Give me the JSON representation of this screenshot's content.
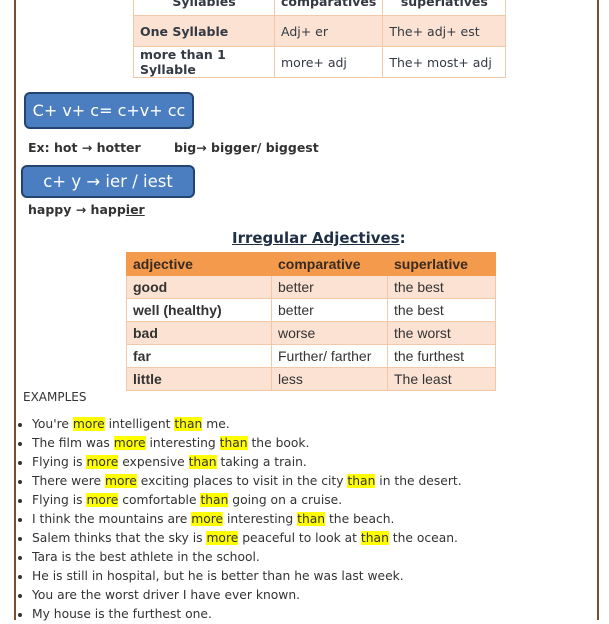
{
  "top_table": {
    "headers": [
      "Syllables",
      "comparatives",
      "superlatives"
    ],
    "rows": [
      [
        "One Syllable",
        "Adj+ er",
        "The+ adj+ est"
      ],
      [
        "more than 1 Syllable",
        "more+ adj",
        "The+ most+ adj"
      ]
    ]
  },
  "rules": [
    {
      "formula": "C+ v+ c= c+v+ cc"
    },
    {
      "formula": "c+ y → ier / iest"
    }
  ],
  "examples_rule1": {
    "prefix": "Ex:",
    "first": "hot → hotter",
    "second": "big→ bigger/ biggest"
  },
  "examples_rule2": {
    "base": "happy → happ",
    "suffix": "ier"
  },
  "irregular": {
    "title": "Irregular Adjectives",
    "title_suffix": ":",
    "headers": [
      "adjective",
      "comparative",
      "superlative"
    ],
    "rows": [
      [
        "good",
        "better",
        "the best"
      ],
      [
        "well (healthy)",
        "better",
        "the best"
      ],
      [
        "bad",
        "worse",
        "the worst"
      ],
      [
        "far",
        "Further/ farther",
        "the furthest"
      ],
      [
        "little",
        "less",
        "The least"
      ]
    ]
  },
  "examples": {
    "label": "EXAMPLES",
    "highlight_color": "#ffff00",
    "items": [
      {
        "segments": [
          {
            "t": "You're "
          },
          {
            "t": "more",
            "h": true
          },
          {
            "t": " intelligent "
          },
          {
            "t": "than",
            "h": true
          },
          {
            "t": " me."
          }
        ]
      },
      {
        "segments": [
          {
            "t": "The film was "
          },
          {
            "t": "more",
            "h": true
          },
          {
            "t": " interesting "
          },
          {
            "t": "than",
            "h": true
          },
          {
            "t": " the book."
          }
        ]
      },
      {
        "segments": [
          {
            "t": "Flying is "
          },
          {
            "t": "more",
            "h": true
          },
          {
            "t": " expensive "
          },
          {
            "t": "than",
            "h": true
          },
          {
            "t": " taking a train."
          }
        ]
      },
      {
        "segments": [
          {
            "t": "There were "
          },
          {
            "t": "more",
            "h": true
          },
          {
            "t": " exciting places to visit in the city "
          },
          {
            "t": "than",
            "h": true
          },
          {
            "t": " in the desert."
          }
        ]
      },
      {
        "segments": [
          {
            "t": "Flying is "
          },
          {
            "t": "more",
            "h": true
          },
          {
            "t": " comfortable "
          },
          {
            "t": "than",
            "h": true
          },
          {
            "t": " going on a cruise."
          }
        ]
      },
      {
        "segments": [
          {
            "t": "I think the mountains are "
          },
          {
            "t": "more",
            "h": true
          },
          {
            "t": " interesting "
          },
          {
            "t": "than",
            "h": true
          },
          {
            "t": " the beach."
          }
        ]
      },
      {
        "segments": [
          {
            "t": "Salem thinks that the sky is "
          },
          {
            "t": "more",
            "h": true
          },
          {
            "t": " peaceful to look at "
          },
          {
            "t": "than",
            "h": true
          },
          {
            "t": " the ocean."
          }
        ]
      },
      {
        "segments": [
          {
            "t": "Tara is the best athlete in the school."
          }
        ]
      },
      {
        "segments": [
          {
            "t": "He is still in hospital, but he is better than he was last week."
          }
        ]
      },
      {
        "segments": [
          {
            "t": "You are the worst driver I have ever known."
          }
        ]
      },
      {
        "segments": [
          {
            "t": "My house is the furthest one."
          }
        ]
      }
    ]
  }
}
